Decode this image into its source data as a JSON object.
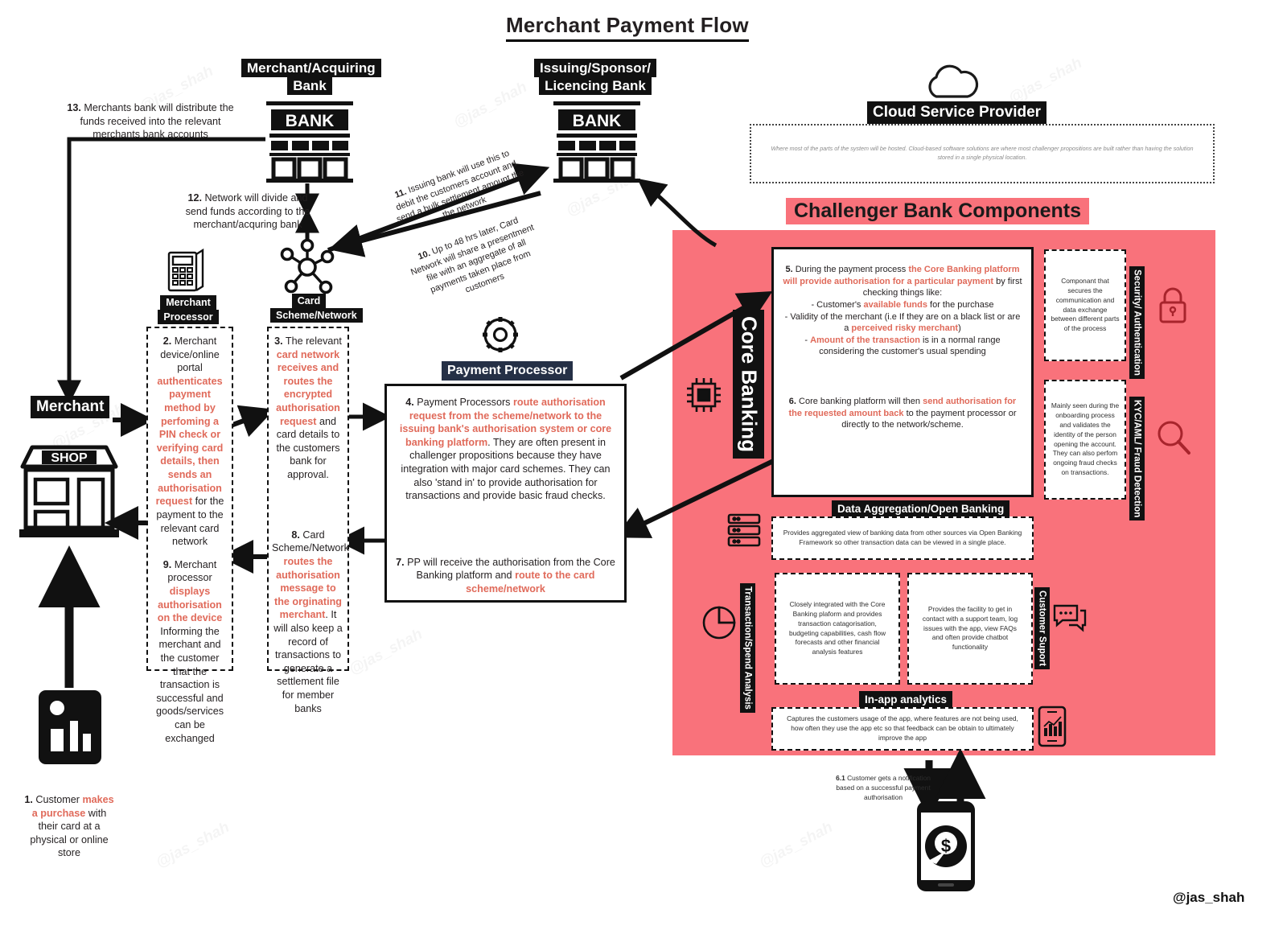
{
  "page": {
    "title": "Merchant Payment Flow",
    "signature": "@jas_shah",
    "watermark": "@jas_shah",
    "accent_pink": "#f9727b",
    "accent_red_text": "#e06a5a",
    "ink": "#111111"
  },
  "nodes": {
    "merchant_acquiring_bank": "Merchant/Acquiring Bank",
    "issuing_sponsor_bank": "Issuing/Sponsor/ Licencing Bank",
    "cloud_service_provider": "Cloud Service Provider",
    "bank_sign": "BANK",
    "merchant": "Merchant",
    "merchant_processor": "Merchant Processor",
    "card_scheme_network": "Card Scheme/Network",
    "payment_processor": "Payment Processor",
    "core_banking": "Core Banking",
    "shop_sign": "SHOP",
    "challenger_header": "Challenger Bank Components"
  },
  "cloud": {
    "description": "Where most of the parts of the system will be hosted. Cloud-based software solutions are where most challenger propositions are built rather than having the solution stored in a single physical location."
  },
  "steps": {
    "s1": {
      "num": "1.",
      "text_parts": [
        "Customer ",
        "makes a purchase",
        " with their card at a physical or online store"
      ]
    },
    "s2": {
      "num": "2.",
      "pre": "Merchant device/online portal ",
      "bold": "authenticates payment method by perfoming a PIN check or verifying card details, then sends an authorisation request",
      "post": " for the payment  to the relevant card network"
    },
    "s3": {
      "num": "3.",
      "pre": "The relevant ",
      "bold": "card network receives and routes the encrypted authorisation request",
      "post": " and card details to the customers bank for approval."
    },
    "s4": {
      "num": "4.",
      "pre": "Payment Processors ",
      "bold": "route authorisation request from the scheme/network to the issuing bank's authorisation system or core banking platform",
      "post": ". They are often present in challenger propositions because they have integration with major card schemes. They can also 'stand in' to provide authorisation for transactions and provide basic fraud checks."
    },
    "s5": {
      "num": "5.",
      "pre": "During the payment process ",
      "bold": "the Core Banking platform will provide authorisation for a particular payment",
      "post": " by first checking things like:",
      "b1pre": "- Customer's ",
      "b1bold": "available funds",
      "b1post": " for the purchase",
      "b2": "- Validity of the merchant (i.e If they are on a black list or are a ",
      "b2bold": "perceived risky merchant",
      "b2post": ")",
      "b3pre": "- ",
      "b3bold": "Amount of the transaction",
      "b3post": " is in a normal range considering the customer's usual spending"
    },
    "s6": {
      "num": "6.",
      "pre": "Core banking platform will then ",
      "bold": "send authorisation for the requested amount back",
      "post": " to the payment processor or directly to the network/scheme."
    },
    "s61": {
      "num": "6.1",
      "text": " Customer gets a notification based on a successful payment authorisation"
    },
    "s7": {
      "num": "7.",
      "pre": "PP will receive the authorisation from the Core Banking platform and ",
      "bold": "route to the card scheme/network"
    },
    "s8": {
      "num": "8.",
      "pre": "Card Scheme/Network ",
      "bold": "routes the authorisation message to the orginating merchant",
      "post": ". It will also keep a record of transactions to generate a settlement file for member banks"
    },
    "s9": {
      "num": "9.",
      "pre": "Merchant processor ",
      "bold": "displays authorisation on the device",
      "post": " Informing the merchant and the customer that the transaction is successful and goods/services can be exchanged"
    },
    "s10": {
      "num": "10.",
      "text": " Up to 48 hrs later, Card Network will share a presentment file with an aggregate of all payments taken place from customers"
    },
    "s11": {
      "num": "11.",
      "text": " Issuing bank will use this to debit the customers account and send a bulk settlement amount the the network"
    },
    "s12": {
      "num": "12.",
      "text": " Network will divide and send funds according to the merchant/acquring bank"
    },
    "s13": {
      "num": "13.",
      "text": " Merchants bank will distribute the funds received into the relevant merchants bank accounts"
    }
  },
  "components": [
    {
      "id": "security-authentication",
      "label": "Security/ Authentication",
      "desc": "Componant that secures the communication and data exchange between different parts of the process",
      "icon": "lock-icon"
    },
    {
      "id": "kyc-aml-fraud",
      "label": "KYC/AML/ Fraud Detection",
      "desc": "Mainly seen during the onboarding process and validates the identity of the person opening the account. They can also perfom ongoing fraud checks on transactions.",
      "icon": "magnifier-icon"
    },
    {
      "id": "data-aggregation",
      "label": "Data Aggregation/Open Banking",
      "desc": "Provides aggregated view of banking data from other sources via Open Banking Framework so other transaction data can be viewed in a single place.",
      "icon": "server-icon"
    },
    {
      "id": "transaction-spend-analysis",
      "label": "Transaction/Spend Analysis",
      "desc": "Closely integrated with the Core Banking plaform and provides transaction catagorisation, budgeting capabilities, cash flow forecasts and other financial analysis features",
      "icon": "pie-chart-icon"
    },
    {
      "id": "customer-support",
      "label": "Customer Suport",
      "desc": "Provides the facility to get in contact with a support team, log issues with the app, view FAQs and often provide chatbot functionality",
      "icon": "chat-icon"
    },
    {
      "id": "in-app-analytics",
      "label": "In-app analytics",
      "desc": "Captures the customers usage of the app, where features are not being used, how often they use the app etc so that feedback can be obtain to ultimately improve the app",
      "icon": "mobile-analytics-icon"
    }
  ]
}
